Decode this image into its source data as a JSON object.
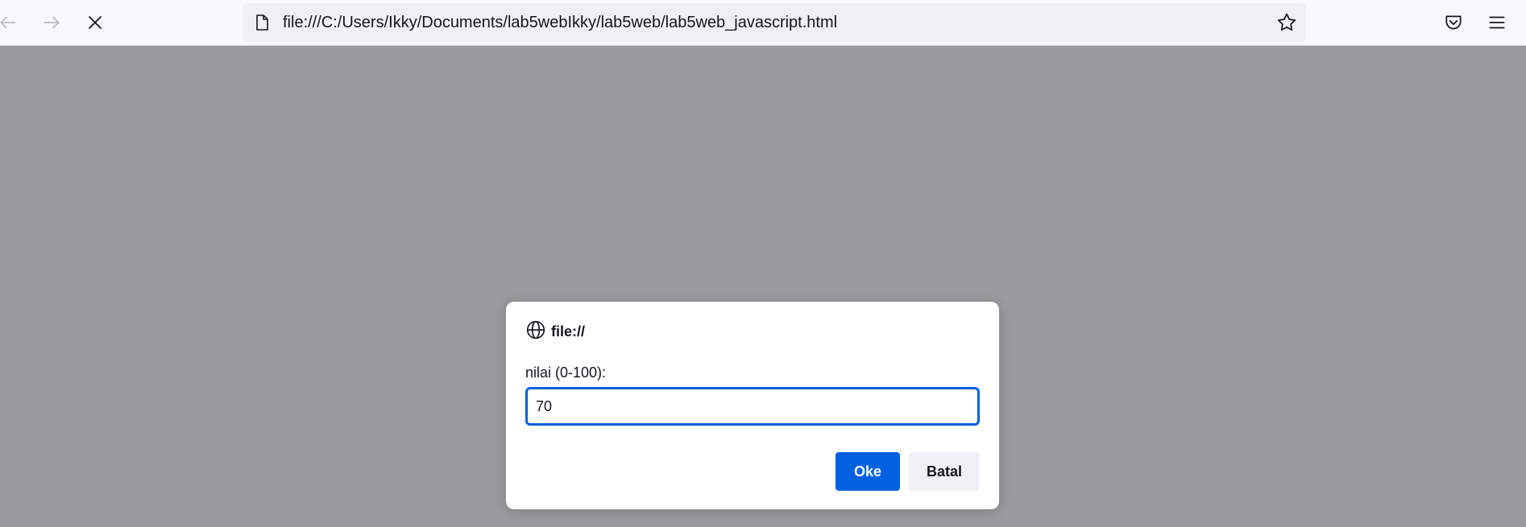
{
  "browser": {
    "url": "file:///C:/Users/Ikky/Documents/lab5webIkky/lab5web/lab5web_javascript.html",
    "icons": {
      "back": "back-arrow-icon",
      "forward": "forward-arrow-icon",
      "stop": "stop-loading-icon",
      "page": "page-icon",
      "bookmark": "star-icon",
      "pocket": "pocket-icon",
      "menu": "hamburger-menu-icon"
    }
  },
  "dialog": {
    "origin": "file://",
    "origin_icon": "globe-icon",
    "prompt_label": "nilai (0-100):",
    "input_value": "70",
    "ok_label": "Oke",
    "cancel_label": "Batal"
  },
  "colors": {
    "accent": "#0061e0",
    "overlay": "#9a9a9c",
    "toolbar": "#f9f9fb"
  }
}
